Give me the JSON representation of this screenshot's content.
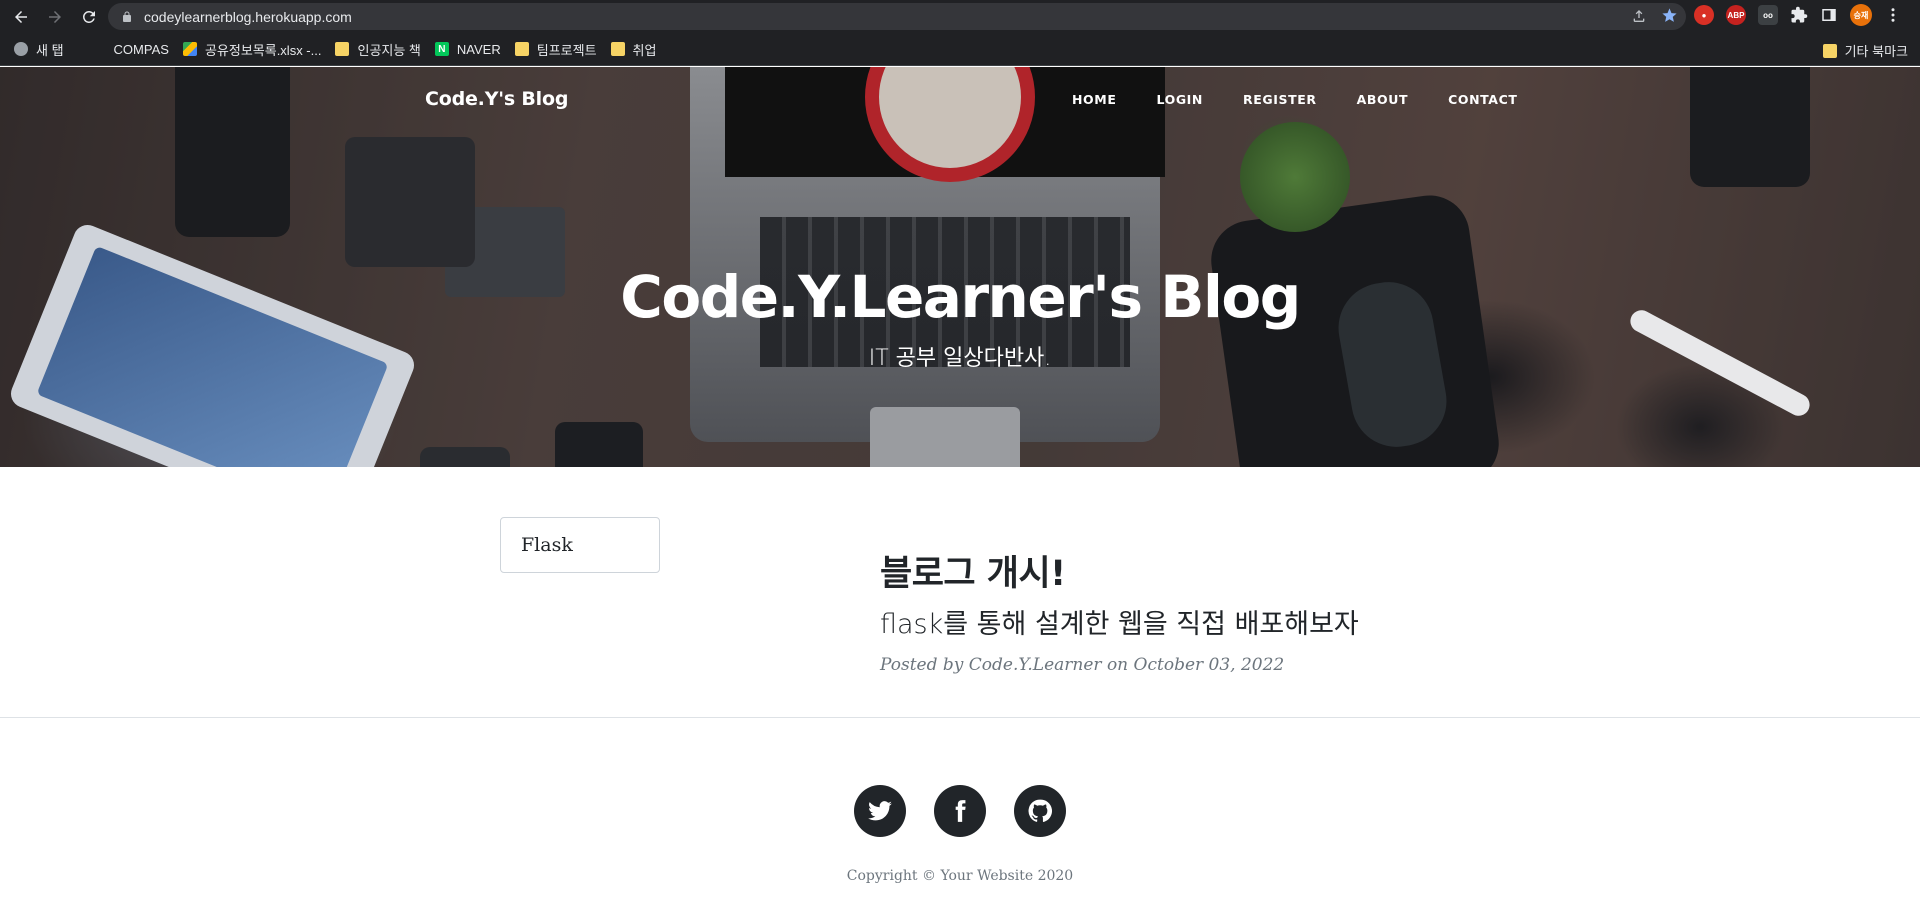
{
  "browser": {
    "url": "codeylearnerblog.herokuapp.com",
    "bookmarks": [
      {
        "label": "새 탭"
      },
      {
        "label": "COMPAS"
      },
      {
        "label": "공유정보목록.xlsx -..."
      },
      {
        "label": "인공지능 책"
      },
      {
        "label": "NAVER"
      },
      {
        "label": "팀프로젝트"
      },
      {
        "label": "취업"
      }
    ],
    "other_bookmarks": "기타 북마크",
    "profile_label": "승재",
    "ext_abp": "ABP"
  },
  "navbar": {
    "brand": "Code.Y's Blog",
    "links": [
      "HOME",
      "LOGIN",
      "REGISTER",
      "ABOUT",
      "CONTACT"
    ]
  },
  "masthead": {
    "title": "Code.Y.Learner's Blog",
    "subtitle": "IT 공부 일상다반사."
  },
  "filter": {
    "value": "Flask"
  },
  "post": {
    "title": "블로그 개시!",
    "subtitle": "flask를 통해 설계한 웹을 직접 배포해보자",
    "meta": "Posted by Code.Y.Learner on October 03, 2022"
  },
  "footer": {
    "social": [
      "twitter-icon",
      "facebook-icon",
      "github-icon"
    ],
    "copyright": "Copyright © Your Website 2020"
  },
  "colors": {
    "chrome_bg": "#202124",
    "omnibox_bg": "#35363a",
    "text_dark": "#212529",
    "meta_gray": "#6c757d",
    "bookmark_star": "#8ab4f8"
  }
}
